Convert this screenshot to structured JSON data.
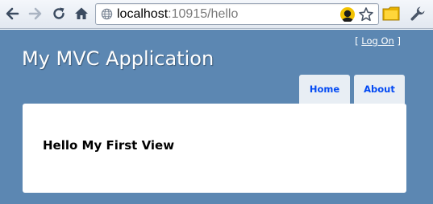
{
  "browser": {
    "url_host": "localhost",
    "url_rest": ":10915/hello",
    "icons": [
      "back-arrow-icon",
      "forward-arrow-icon",
      "reload-icon",
      "home-icon",
      "globe-icon",
      "extension-icon",
      "star-icon",
      "folder-icon",
      "wrench-icon"
    ]
  },
  "page": {
    "login_prefix": "[",
    "login_link": "Log On",
    "login_suffix": "]",
    "site_title": "My MVC Application",
    "menu": [
      {
        "label": "Home"
      },
      {
        "label": "About"
      }
    ],
    "heading": "Hello My First View"
  },
  "colors": {
    "page_background": "#5c87b2",
    "tab_background": "#e8eef4",
    "tab_text": "#034af3",
    "content_background": "#ffffff"
  }
}
